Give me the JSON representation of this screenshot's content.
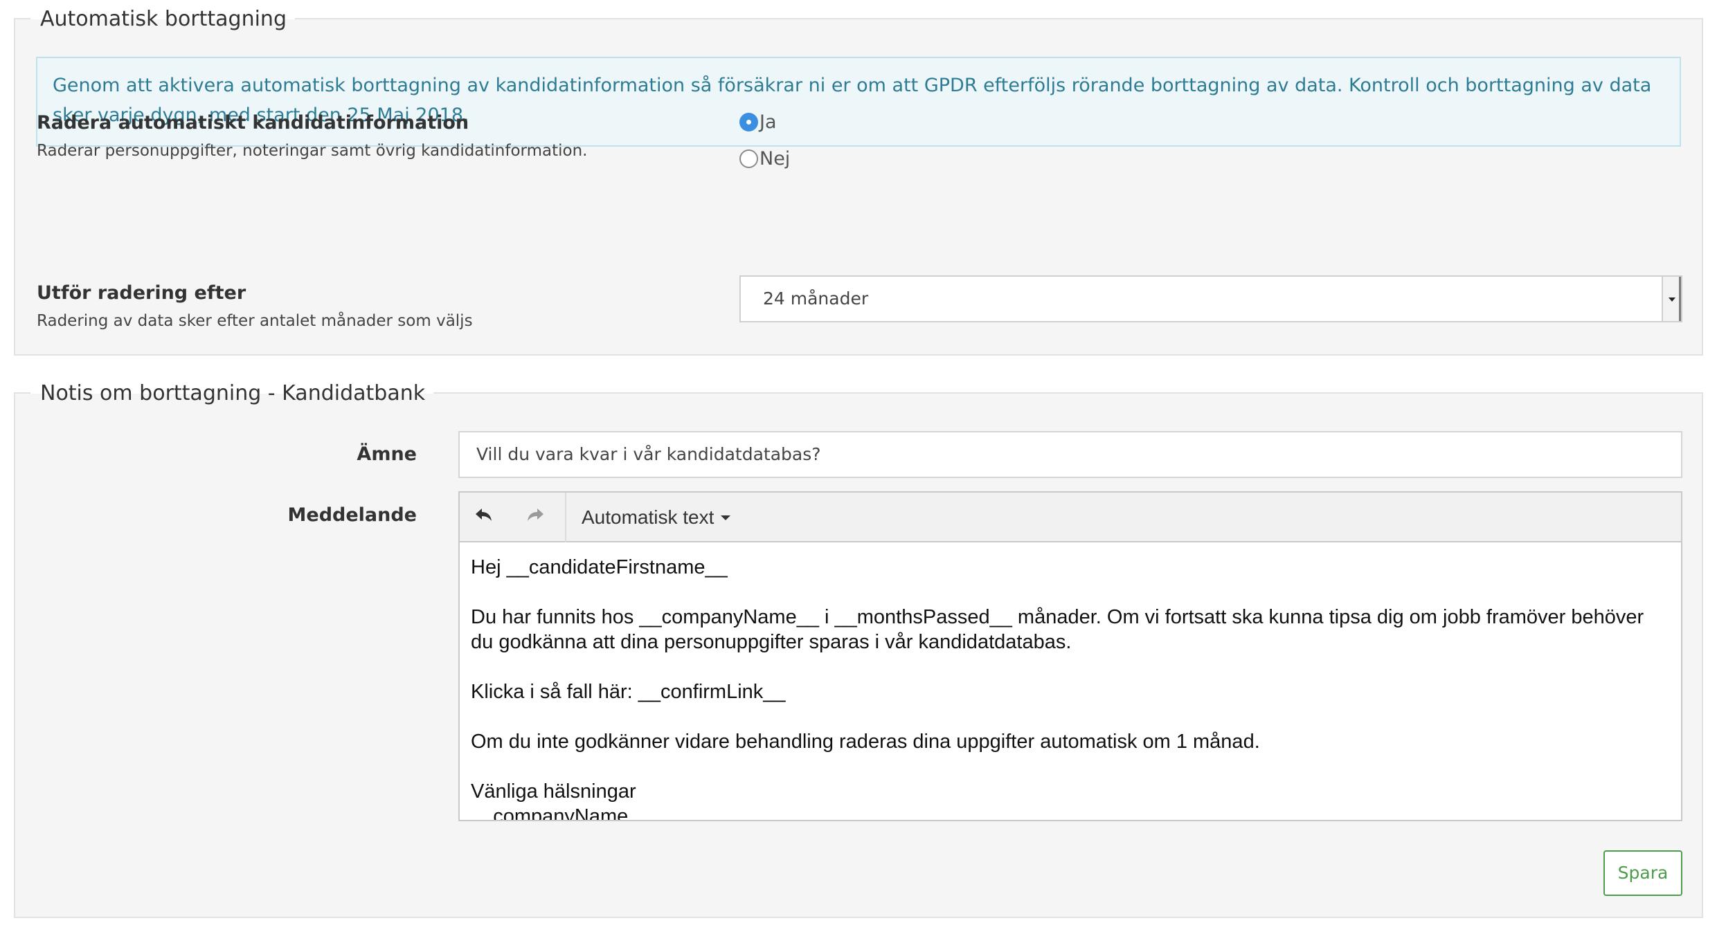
{
  "auto_delete": {
    "legend": "Automatisk borttagning",
    "info": "Genom att aktivera automatisk borttagning av kandidatinformation så försäkrar ni er om att GPDR efterföljs rörande borttagning av data. Kontroll och borttagning av data sker varje dygn, med start den 25 Maj 2018.",
    "enable": {
      "title": "Radera automatiskt kandidatinformation",
      "help": "Raderar personuppgifter, noteringar samt övrig kandidatinformation.",
      "options": [
        {
          "label": "Ja",
          "checked": true
        },
        {
          "label": "Nej",
          "checked": false
        }
      ]
    },
    "delay": {
      "title": "Utför radering efter",
      "help": "Radering av data sker efter antalet månader som väljs",
      "selected": "24 månader"
    }
  },
  "notice": {
    "legend": "Notis om borttagning - Kandidatbank",
    "subject_label": "Ämne",
    "subject_value": "Vill du vara kvar i vår kandidatdatabas?",
    "message_label": "Meddelande",
    "toolbar": {
      "undo_icon": "undo-icon",
      "redo_icon": "redo-icon",
      "menu_label": "Automatisk text"
    },
    "message_paragraphs": [
      "Hej __candidateFirstname__",
      "Du har funnits hos __companyName__ i __monthsPassed__ månader. Om vi fortsatt ska kunna tipsa dig om jobb framöver behöver du godkänna att dina personuppgifter sparas i vår kandidatdatabas.",
      "Klicka i så fall här: __confirmLink__",
      "Om du inte godkänner vidare behandling raderas dina uppgifter automatisk om 1 månad.",
      "Vänliga hälsningar\n__companyName__"
    ],
    "save_label": "Spara"
  },
  "colors": {
    "info_text": "#2e7c94",
    "info_border": "#bfe1ec",
    "radio_checked": "#3b8fe0",
    "save_green": "#4d9c4d"
  }
}
